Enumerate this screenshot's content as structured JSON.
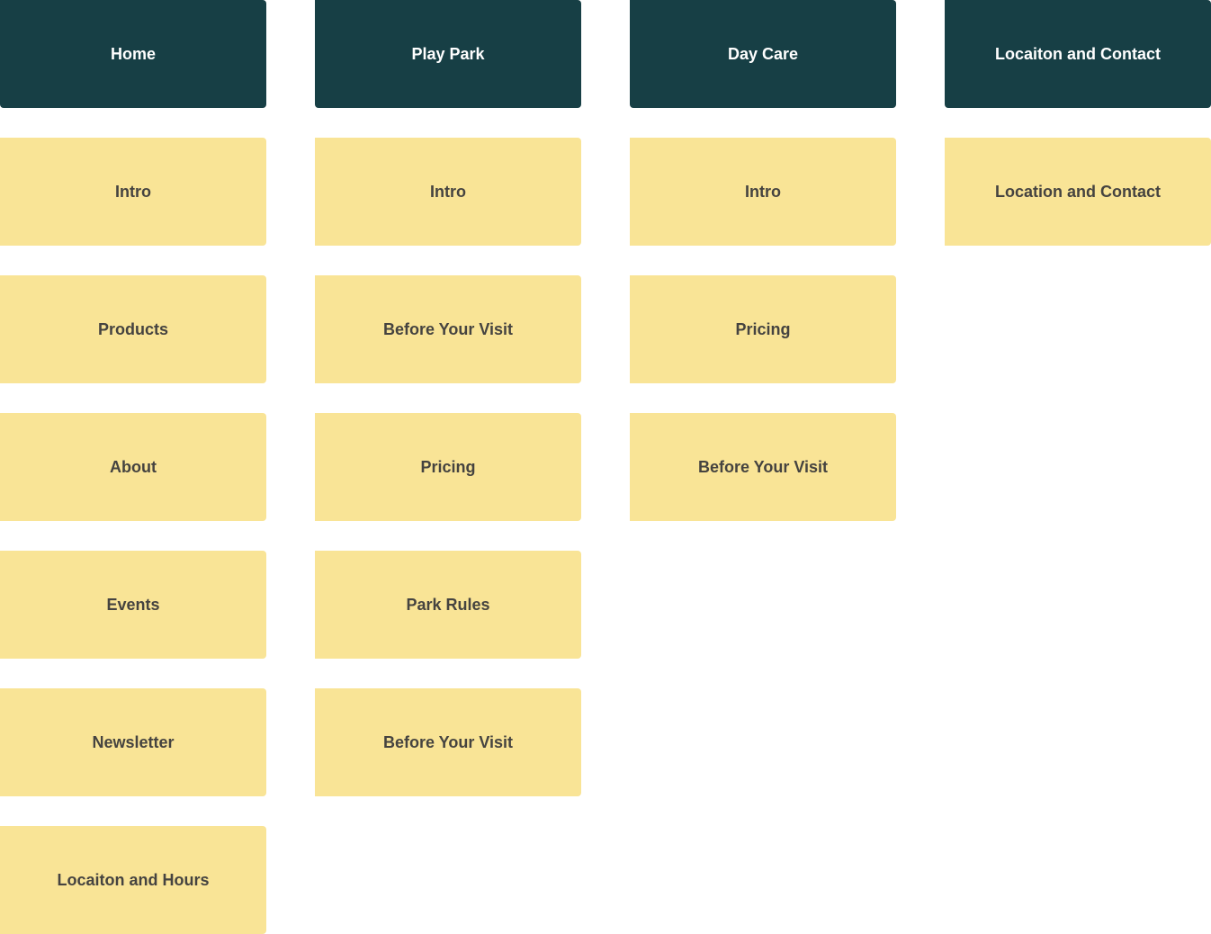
{
  "colors": {
    "header_bg": "#173f45",
    "header_text": "#ffffff",
    "section_bg": "#f9e496",
    "section_text": "#454340",
    "page_bg": "#ffffff"
  },
  "sitemap": {
    "columns": [
      {
        "page": "Home",
        "sections": [
          "Intro",
          "Products",
          "About",
          "Events",
          "Newsletter",
          "Locaiton and Hours"
        ]
      },
      {
        "page": "Play Park",
        "sections": [
          "Intro",
          "Before Your Visit",
          "Pricing",
          "Park Rules",
          "Before Your Visit"
        ]
      },
      {
        "page": "Day Care",
        "sections": [
          "Intro",
          "Pricing",
          "Before Your Visit"
        ]
      },
      {
        "page": "Locaiton and Contact",
        "sections": [
          "Location and Contact"
        ]
      }
    ]
  }
}
